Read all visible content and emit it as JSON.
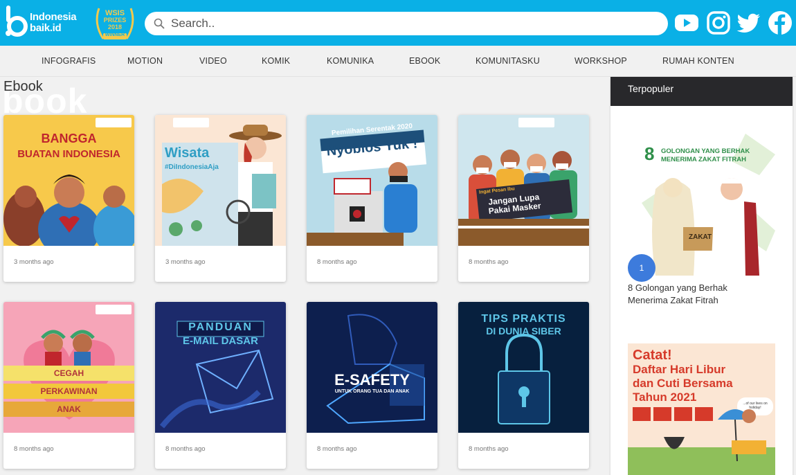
{
  "header": {
    "logo_line1": "Indonesia",
    "logo_line2": "baik.id",
    "award_line1": "WSIS",
    "award_line2": "PRIZES",
    "award_line3": "2018",
    "award_line4": "WINNER",
    "search_placeholder": "Search..",
    "social": [
      "youtube-icon",
      "instagram-icon",
      "twitter-icon",
      "facebook-icon"
    ]
  },
  "nav": {
    "items": [
      "INFOGRAFIS",
      "MOTION",
      "VIDEO",
      "KOMIK",
      "KOMUNIKA",
      "EBOOK",
      "KOMUNITASKU",
      "WORKSHOP",
      "RUMAH KONTEN"
    ]
  },
  "section": {
    "title": "Ebook",
    "ghost": "book"
  },
  "cards": [
    {
      "date": "3 months ago",
      "t1": "BANGGA",
      "t2": "BUATAN INDONESIA"
    },
    {
      "date": "3 months ago",
      "t1": "Wisata",
      "t2": "#DiIndonesiaAja"
    },
    {
      "date": "8 months ago",
      "t1": "Pemilihan Serentak 2020",
      "t2": "Nyoblos Yuk !"
    },
    {
      "date": "8 months ago",
      "t1": "Ingat Pesan Ibu",
      "t2": "Jangan Lupa Pakai Masker"
    },
    {
      "date": "8 months ago",
      "t1": "CEGAH",
      "t2": "PERKAWINAN",
      "t3": "ANAK"
    },
    {
      "date": "8 months ago",
      "t1": "PANDUAN",
      "t2": "E-MAIL DASAR"
    },
    {
      "date": "8 months ago",
      "t1": "E-SAFETY",
      "t2": "UNTUK ORANG TUA DAN ANAK"
    },
    {
      "date": "8 months ago",
      "t1": "TIPS PRAKTIS",
      "t2": "DI DUNIA SIBER"
    }
  ],
  "sidebar": {
    "header": "Terpopuler",
    "items": [
      {
        "rank": "1",
        "title": "8 Golongan yang Berhak Menerima Zakat Fitrah",
        "img_t1": "8",
        "img_t2": "GOLONGAN YANG BERHAK",
        "img_t3": "MENERIMA ZAKAT FITRAH",
        "img_label": "ZAKAT"
      },
      {
        "img_t1": "Catat!",
        "img_t2": "Daftar Hari Libur",
        "img_t3": "dan Cuti Bersama",
        "img_t4": "Tahun 2021",
        "img_bubble": "...of our lives on holiday!"
      }
    ]
  },
  "colors": {
    "brand_blue": "#0ab0e6",
    "sidebar_header": "#28282b",
    "badge_blue": "#3d7bdc"
  }
}
